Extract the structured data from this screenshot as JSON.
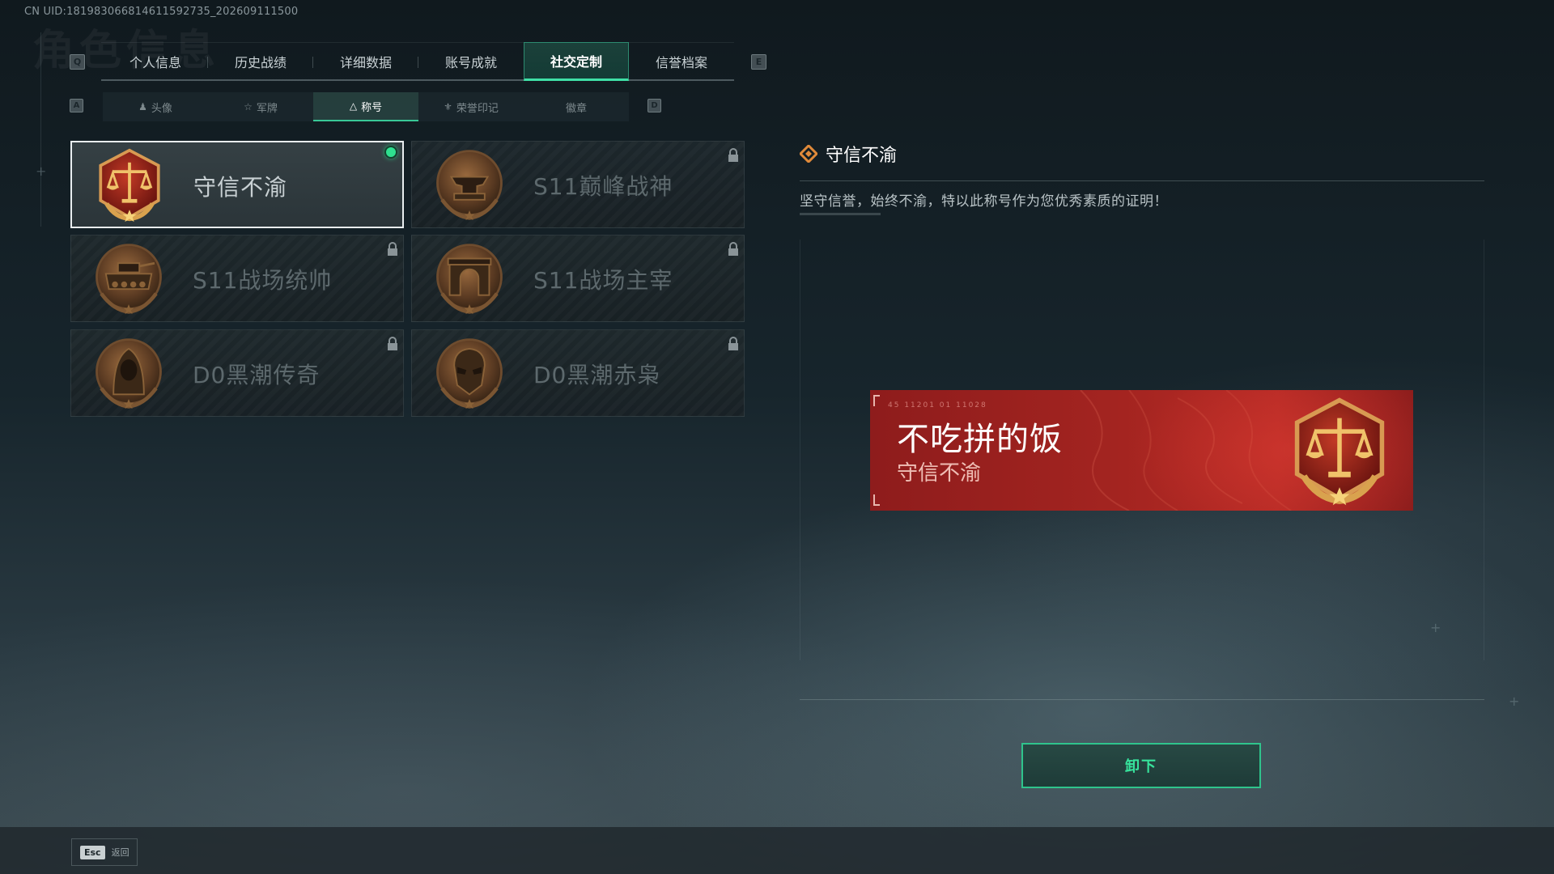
{
  "uid_text": "CN UID:18198306681461159​2735_202609111500",
  "ghost_title": "角色信息",
  "top_tabs": {
    "left_key": "Q",
    "right_key": "E",
    "items": [
      {
        "label": "个人信息"
      },
      {
        "label": "历史战绩"
      },
      {
        "label": "详细数据"
      },
      {
        "label": "账号成就"
      },
      {
        "label": "社交定制"
      },
      {
        "label": "信誉档案"
      }
    ],
    "active_index": 4
  },
  "sub_tabs": {
    "left_key": "A",
    "right_key": "D",
    "items": [
      {
        "label": "头像",
        "icon": "person-icon"
      },
      {
        "label": "军牌",
        "icon": "dogtag-icon"
      },
      {
        "label": "称号",
        "icon": "triangle-title-icon"
      },
      {
        "label": "荣誉印记",
        "icon": "honor-mark-icon"
      },
      {
        "label": "徽章",
        "icon": ""
      }
    ],
    "active_index": 2
  },
  "titles": [
    {
      "name": "守信不渝",
      "emblem": "scales-of-justice",
      "selected": true,
      "equipped": true,
      "locked": false
    },
    {
      "name": "S11巅峰战神",
      "emblem": "anvil",
      "selected": false,
      "equipped": false,
      "locked": true
    },
    {
      "name": "S11战场统帅",
      "emblem": "tank",
      "selected": false,
      "equipped": false,
      "locked": true
    },
    {
      "name": "S11战场主宰",
      "emblem": "arch",
      "selected": false,
      "equipped": false,
      "locked": true
    },
    {
      "name": "D0黑潮传奇",
      "emblem": "hooded-figure",
      "selected": false,
      "equipped": false,
      "locked": true
    },
    {
      "name": "D0黑潮赤枭",
      "emblem": "masked-skull",
      "selected": false,
      "equipped": false,
      "locked": true
    }
  ],
  "detail": {
    "title": "守信不渝",
    "description": "坚守信誉，始终不渝，特以此称号作为您优秀素质的证明！"
  },
  "banner": {
    "player_name": "不吃拼的饭",
    "title": "守信不渝",
    "code": "45 11201  01 11028"
  },
  "action_button": "卸下",
  "footer": {
    "esc_key": "Esc",
    "esc_label": "返回"
  },
  "colors": {
    "accent": "#37e39c",
    "banner_red": "#a32420",
    "emblem_bronze": "#c08a4a"
  }
}
